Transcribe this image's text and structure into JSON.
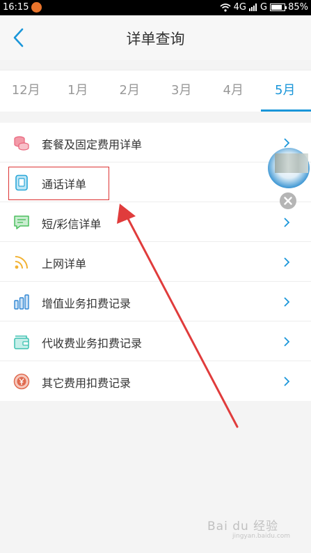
{
  "status_bar": {
    "time": "16:15",
    "signal_text": "4G",
    "signal_text_2": "G",
    "battery_percent": "85%",
    "battery_level": 0.85
  },
  "header": {
    "title": "详单查询",
    "back_icon": "chevron-left-icon"
  },
  "month_tabs": [
    {
      "label": "12月",
      "active": false
    },
    {
      "label": "1月",
      "active": false
    },
    {
      "label": "2月",
      "active": false
    },
    {
      "label": "3月",
      "active": false
    },
    {
      "label": "4月",
      "active": false
    },
    {
      "label": "5月",
      "active": true
    }
  ],
  "menu": {
    "items": [
      {
        "label": "套餐及固定费用详单",
        "icon": "coins-icon",
        "icon_color": "#e8637a"
      },
      {
        "label": "通话详单",
        "icon": "phone-icon",
        "icon_color": "#2aa7d8"
      },
      {
        "label": "短/彩信详单",
        "icon": "message-icon",
        "icon_color": "#4cbf5f"
      },
      {
        "label": "上网详单",
        "icon": "wifi-icon",
        "icon_color": "#f2b233"
      },
      {
        "label": "增值业务扣费记录",
        "icon": "bar-chart-icon",
        "icon_color": "#2f86d3"
      },
      {
        "label": "代收费业务扣费记录",
        "icon": "wallet-icon",
        "icon_color": "#3cc1b0"
      },
      {
        "label": "其它费用扣费记录",
        "icon": "yuan-coin-icon",
        "icon_color": "#e06a4f"
      }
    ]
  },
  "watermark": {
    "text": "Bai du 经验",
    "sub": "jingyan.baidu.com"
  },
  "colors": {
    "accent": "#1a96d9",
    "annotation": "#e03c3c"
  }
}
